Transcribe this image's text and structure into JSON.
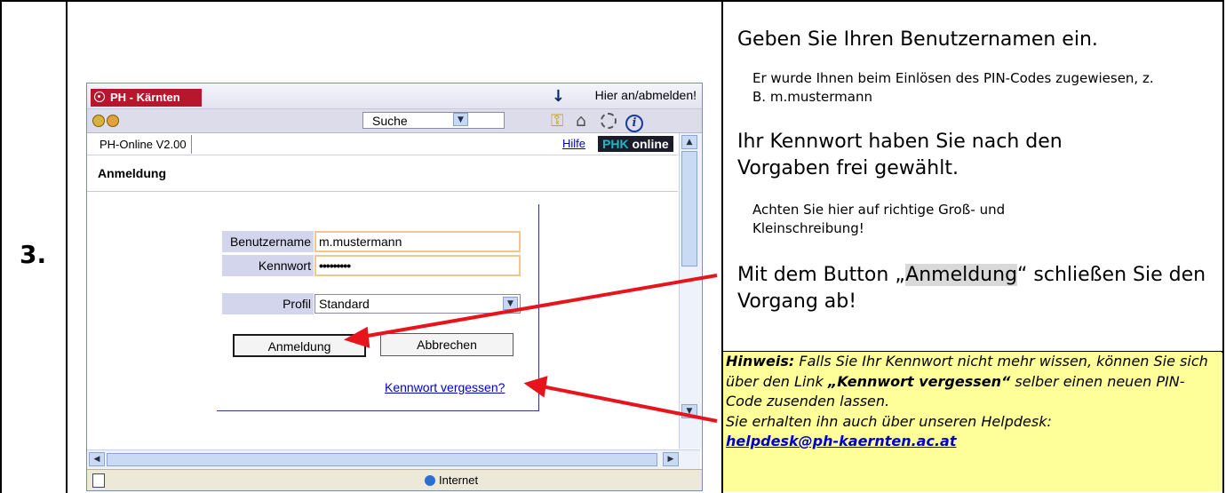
{
  "step": {
    "number": "3."
  },
  "browser": {
    "logo": "PH - Kärnten",
    "login_link": "Hier an/abmelden!",
    "search": "Suche",
    "tab": "PH-Online V2.00",
    "help": "Hilfe",
    "brand_a": "PHK",
    "brand_b": "online",
    "heading": "Anmeldung",
    "status_zone": "Internet",
    "icons": [
      "back-icon",
      "forward-icon",
      "key-icon",
      "home-icon",
      "logout-icon",
      "info-icon"
    ]
  },
  "form": {
    "username_label": "Benutzername",
    "username_value": "m.mustermann",
    "password_label": "Kennwort",
    "password_value": "•••••••••",
    "profile_label": "Profil",
    "profile_value": "Standard",
    "login_button": "Anmeldung",
    "cancel_button": "Abbrechen",
    "forgot_link": "Kennwort vergessen?"
  },
  "instructions": {
    "p1": "Geben Sie Ihren Benutzernamen ein.",
    "p1_note": "Er wurde Ihnen beim Einlösen des PIN-Codes zugewiesen, z. B. m.mustermann",
    "p2": "Ihr Kennwort haben Sie nach den Vorgaben frei gewählt.",
    "p2_note": "Achten Sie hier auf richtige Groß- und Kleinschreibung!",
    "p3_pre": "Mit dem Button „",
    "p3_button": "Anmeldung",
    "p3_post": "“ schließen Sie den Vorgang ab!"
  },
  "note": {
    "label": "Hinweis:",
    "text1": " Falls Sie Ihr Kennwort nicht mehr wissen, können Sie sich über den Link ",
    "link_name": "„Kennwort vergessen“",
    "text2": " selber einen neuen PIN-Code zusenden lassen.",
    "text3": "Sie erhalten ihn auch über unseren Helpdesk:",
    "email": "helpdesk@ph-kaernten.ac.at"
  },
  "colors": {
    "arrow": "#e8141c",
    "note_bg": "#ffff99",
    "logo_bg": "#b8162c",
    "link": "#0000cc"
  }
}
